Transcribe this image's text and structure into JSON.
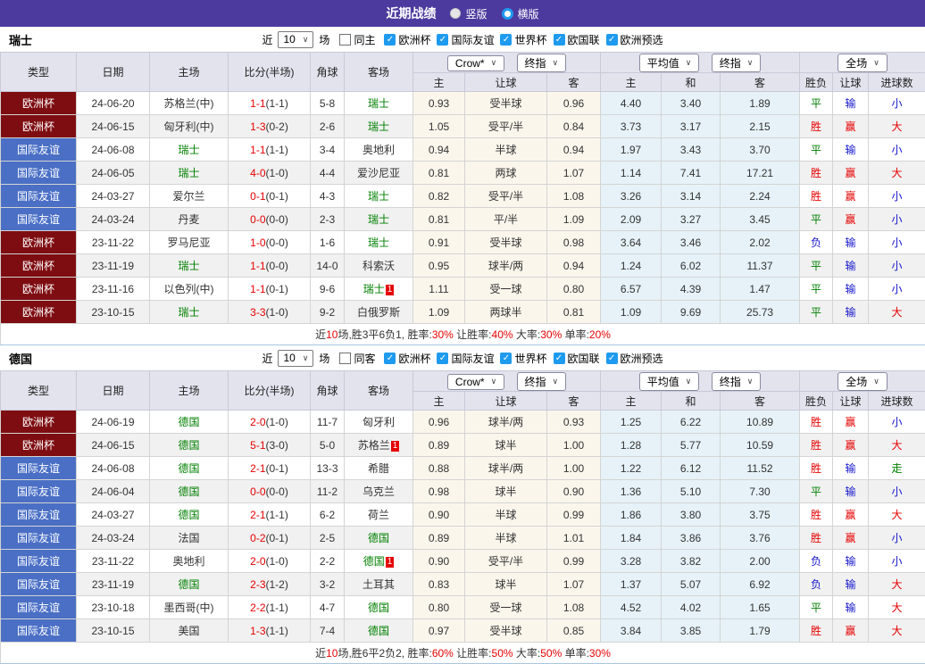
{
  "header": {
    "title": "近期战绩",
    "radio_vertical": "竖版",
    "radio_horizontal": "横版"
  },
  "filter": {
    "near_label": "近",
    "near_value": "10",
    "games_label": "场",
    "leagues": [
      "欧洲杯",
      "国际友谊",
      "世界杯",
      "欧国联",
      "欧洲预选"
    ]
  },
  "columns": {
    "main": [
      "类型",
      "日期",
      "主场",
      "比分(半场)",
      "角球",
      "客场"
    ],
    "sub": [
      "主",
      "让球",
      "客",
      "主",
      "和",
      "客",
      "胜负",
      "让球",
      "进球数"
    ],
    "dropdowns": {
      "crow": "Crow*",
      "final": "终指",
      "avg": "平均值",
      "full": "全场"
    }
  },
  "colors": {
    "topbar_bg": "#4C3A9E",
    "header_cell_bg": "#E3E3EE",
    "cup_bg": "#7E0D11",
    "friendly_bg": "#4A6FC5",
    "team_green": "#008000",
    "score_red": "#E60000",
    "result_red": "#E60000",
    "result_blue": "#1515CD",
    "result_green": "#008000",
    "crow_col_bg": "#FBF6EC",
    "avg_col_bg": "#E6F2F8",
    "stripe_bg": "#F1F1F1",
    "checkbox_blue": "#1E9AEF",
    "badge_red": "#E60000"
  },
  "tables": [
    {
      "team": "瑞士",
      "same_label": "同主",
      "rows": [
        {
          "league": "欧洲杯",
          "league_type": "cup",
          "date": "24-06-20",
          "home": "苏格兰(中)",
          "home_highlight": false,
          "home_badge": "",
          "score": "1-1",
          "half_score": "(1-1)",
          "corners": "5-8",
          "away": "瑞士",
          "away_highlight": true,
          "away_badge": "",
          "crow_home": "0.93",
          "handicap": "受半球",
          "crow_away": "0.96",
          "avg_home": "4.40",
          "avg_draw": "3.40",
          "avg_away": "1.89",
          "result_wdl": "平",
          "result_wdl_color": "green",
          "result_handicap": "输",
          "result_handicap_color": "blue",
          "result_goals": "小",
          "result_goals_color": "blue"
        },
        {
          "league": "欧洲杯",
          "league_type": "cup",
          "date": "24-06-15",
          "home": "匈牙利(中)",
          "home_highlight": false,
          "home_badge": "",
          "score": "1-3",
          "half_score": "(0-2)",
          "corners": "2-6",
          "away": "瑞士",
          "away_highlight": true,
          "away_badge": "",
          "crow_home": "1.05",
          "handicap": "受平/半",
          "crow_away": "0.84",
          "avg_home": "3.73",
          "avg_draw": "3.17",
          "avg_away": "2.15",
          "result_wdl": "胜",
          "result_wdl_color": "red",
          "result_handicap": "赢",
          "result_handicap_color": "red",
          "result_goals": "大",
          "result_goals_color": "red"
        },
        {
          "league": "国际友谊",
          "league_type": "friendly",
          "date": "24-06-08",
          "home": "瑞士",
          "home_highlight": true,
          "home_badge": "",
          "score": "1-1",
          "half_score": "(1-1)",
          "corners": "3-4",
          "away": "奥地利",
          "away_highlight": false,
          "away_badge": "",
          "crow_home": "0.94",
          "handicap": "半球",
          "crow_away": "0.94",
          "avg_home": "1.97",
          "avg_draw": "3.43",
          "avg_away": "3.70",
          "result_wdl": "平",
          "result_wdl_color": "green",
          "result_handicap": "输",
          "result_handicap_color": "blue",
          "result_goals": "小",
          "result_goals_color": "blue"
        },
        {
          "league": "国际友谊",
          "league_type": "friendly",
          "date": "24-06-05",
          "home": "瑞士",
          "home_highlight": true,
          "home_badge": "",
          "score": "4-0",
          "half_score": "(1-0)",
          "corners": "4-4",
          "away": "爱沙尼亚",
          "away_highlight": false,
          "away_badge": "",
          "crow_home": "0.81",
          "handicap": "两球",
          "crow_away": "1.07",
          "avg_home": "1.14",
          "avg_draw": "7.41",
          "avg_away": "17.21",
          "result_wdl": "胜",
          "result_wdl_color": "red",
          "result_handicap": "赢",
          "result_handicap_color": "red",
          "result_goals": "大",
          "result_goals_color": "red"
        },
        {
          "league": "国际友谊",
          "league_type": "friendly",
          "date": "24-03-27",
          "home": "爱尔兰",
          "home_highlight": false,
          "home_badge": "",
          "score": "0-1",
          "half_score": "(0-1)",
          "corners": "4-3",
          "away": "瑞士",
          "away_highlight": true,
          "away_badge": "",
          "crow_home": "0.82",
          "handicap": "受平/半",
          "crow_away": "1.08",
          "avg_home": "3.26",
          "avg_draw": "3.14",
          "avg_away": "2.24",
          "result_wdl": "胜",
          "result_wdl_color": "red",
          "result_handicap": "赢",
          "result_handicap_color": "red",
          "result_goals": "小",
          "result_goals_color": "blue"
        },
        {
          "league": "国际友谊",
          "league_type": "friendly",
          "date": "24-03-24",
          "home": "丹麦",
          "home_highlight": false,
          "home_badge": "",
          "score": "0-0",
          "half_score": "(0-0)",
          "corners": "2-3",
          "away": "瑞士",
          "away_highlight": true,
          "away_badge": "",
          "crow_home": "0.81",
          "handicap": "平/半",
          "crow_away": "1.09",
          "avg_home": "2.09",
          "avg_draw": "3.27",
          "avg_away": "3.45",
          "result_wdl": "平",
          "result_wdl_color": "green",
          "result_handicap": "赢",
          "result_handicap_color": "red",
          "result_goals": "小",
          "result_goals_color": "blue"
        },
        {
          "league": "欧洲杯",
          "league_type": "cup",
          "date": "23-11-22",
          "home": "罗马尼亚",
          "home_highlight": false,
          "home_badge": "",
          "score": "1-0",
          "half_score": "(0-0)",
          "corners": "1-6",
          "away": "瑞士",
          "away_highlight": true,
          "away_badge": "",
          "crow_home": "0.91",
          "handicap": "受半球",
          "crow_away": "0.98",
          "avg_home": "3.64",
          "avg_draw": "3.46",
          "avg_away": "2.02",
          "result_wdl": "负",
          "result_wdl_color": "blue",
          "result_handicap": "输",
          "result_handicap_color": "blue",
          "result_goals": "小",
          "result_goals_color": "blue"
        },
        {
          "league": "欧洲杯",
          "league_type": "cup",
          "date": "23-11-19",
          "home": "瑞士",
          "home_highlight": true,
          "home_badge": "",
          "score": "1-1",
          "half_score": "(0-0)",
          "corners": "14-0",
          "away": "科索沃",
          "away_highlight": false,
          "away_badge": "",
          "crow_home": "0.95",
          "handicap": "球半/两",
          "crow_away": "0.94",
          "avg_home": "1.24",
          "avg_draw": "6.02",
          "avg_away": "11.37",
          "result_wdl": "平",
          "result_wdl_color": "green",
          "result_handicap": "输",
          "result_handicap_color": "blue",
          "result_goals": "小",
          "result_goals_color": "blue"
        },
        {
          "league": "欧洲杯",
          "league_type": "cup",
          "date": "23-11-16",
          "home": "以色列(中)",
          "home_highlight": false,
          "home_badge": "",
          "score": "1-1",
          "half_score": "(0-1)",
          "corners": "9-6",
          "away": "瑞士",
          "away_highlight": true,
          "away_badge": "1",
          "crow_home": "1.11",
          "handicap": "受一球",
          "crow_away": "0.80",
          "avg_home": "6.57",
          "avg_draw": "4.39",
          "avg_away": "1.47",
          "result_wdl": "平",
          "result_wdl_color": "green",
          "result_handicap": "输",
          "result_handicap_color": "blue",
          "result_goals": "小",
          "result_goals_color": "blue"
        },
        {
          "league": "欧洲杯",
          "league_type": "cup",
          "date": "23-10-15",
          "home": "瑞士",
          "home_highlight": true,
          "home_badge": "",
          "score": "3-3",
          "half_score": "(1-0)",
          "corners": "9-2",
          "away": "白俄罗斯",
          "away_highlight": false,
          "away_badge": "",
          "crow_home": "1.09",
          "handicap": "两球半",
          "crow_away": "0.81",
          "avg_home": "1.09",
          "avg_draw": "9.69",
          "avg_away": "25.73",
          "result_wdl": "平",
          "result_wdl_color": "green",
          "result_handicap": "输",
          "result_handicap_color": "blue",
          "result_goals": "大",
          "result_goals_color": "red"
        }
      ],
      "summary": [
        {
          "text": "近",
          "red": false
        },
        {
          "text": "10",
          "red": true
        },
        {
          "text": "场,胜3平6负1, 胜率:",
          "red": false
        },
        {
          "text": "30%",
          "red": true
        },
        {
          "text": " 让胜率:",
          "red": false
        },
        {
          "text": "40%",
          "red": true
        },
        {
          "text": " 大率:",
          "red": false
        },
        {
          "text": "30%",
          "red": true
        },
        {
          "text": " 单率:",
          "red": false
        },
        {
          "text": "20%",
          "red": true
        }
      ]
    },
    {
      "team": "德国",
      "same_label": "同客",
      "rows": [
        {
          "league": "欧洲杯",
          "league_type": "cup",
          "date": "24-06-19",
          "home": "德国",
          "home_highlight": true,
          "home_badge": "",
          "score": "2-0",
          "half_score": "(1-0)",
          "corners": "11-7",
          "away": "匈牙利",
          "away_highlight": false,
          "away_badge": "",
          "crow_home": "0.96",
          "handicap": "球半/两",
          "crow_away": "0.93",
          "avg_home": "1.25",
          "avg_draw": "6.22",
          "avg_away": "10.89",
          "result_wdl": "胜",
          "result_wdl_color": "red",
          "result_handicap": "赢",
          "result_handicap_color": "red",
          "result_goals": "小",
          "result_goals_color": "blue"
        },
        {
          "league": "欧洲杯",
          "league_type": "cup",
          "date": "24-06-15",
          "home": "德国",
          "home_highlight": true,
          "home_badge": "",
          "score": "5-1",
          "half_score": "(3-0)",
          "corners": "5-0",
          "away": "苏格兰",
          "away_highlight": false,
          "away_badge": "1",
          "crow_home": "0.89",
          "handicap": "球半",
          "crow_away": "1.00",
          "avg_home": "1.28",
          "avg_draw": "5.77",
          "avg_away": "10.59",
          "result_wdl": "胜",
          "result_wdl_color": "red",
          "result_handicap": "赢",
          "result_handicap_color": "red",
          "result_goals": "大",
          "result_goals_color": "red"
        },
        {
          "league": "国际友谊",
          "league_type": "friendly",
          "date": "24-06-08",
          "home": "德国",
          "home_highlight": true,
          "home_badge": "",
          "score": "2-1",
          "half_score": "(0-1)",
          "corners": "13-3",
          "away": "希腊",
          "away_highlight": false,
          "away_badge": "",
          "crow_home": "0.88",
          "handicap": "球半/两",
          "crow_away": "1.00",
          "avg_home": "1.22",
          "avg_draw": "6.12",
          "avg_away": "11.52",
          "result_wdl": "胜",
          "result_wdl_color": "red",
          "result_handicap": "输",
          "result_handicap_color": "blue",
          "result_goals": "走",
          "result_goals_color": "green"
        },
        {
          "league": "国际友谊",
          "league_type": "friendly",
          "date": "24-06-04",
          "home": "德国",
          "home_highlight": true,
          "home_badge": "",
          "score": "0-0",
          "half_score": "(0-0)",
          "corners": "11-2",
          "away": "乌克兰",
          "away_highlight": false,
          "away_badge": "",
          "crow_home": "0.98",
          "handicap": "球半",
          "crow_away": "0.90",
          "avg_home": "1.36",
          "avg_draw": "5.10",
          "avg_away": "7.30",
          "result_wdl": "平",
          "result_wdl_color": "green",
          "result_handicap": "输",
          "result_handicap_color": "blue",
          "result_goals": "小",
          "result_goals_color": "blue"
        },
        {
          "league": "国际友谊",
          "league_type": "friendly",
          "date": "24-03-27",
          "home": "德国",
          "home_highlight": true,
          "home_badge": "",
          "score": "2-1",
          "half_score": "(1-1)",
          "corners": "6-2",
          "away": "荷兰",
          "away_highlight": false,
          "away_badge": "",
          "crow_home": "0.90",
          "handicap": "半球",
          "crow_away": "0.99",
          "avg_home": "1.86",
          "avg_draw": "3.80",
          "avg_away": "3.75",
          "result_wdl": "胜",
          "result_wdl_color": "red",
          "result_handicap": "赢",
          "result_handicap_color": "red",
          "result_goals": "大",
          "result_goals_color": "red"
        },
        {
          "league": "国际友谊",
          "league_type": "friendly",
          "date": "24-03-24",
          "home": "法国",
          "home_highlight": false,
          "home_badge": "",
          "score": "0-2",
          "half_score": "(0-1)",
          "corners": "2-5",
          "away": "德国",
          "away_highlight": true,
          "away_badge": "",
          "crow_home": "0.89",
          "handicap": "半球",
          "crow_away": "1.01",
          "avg_home": "1.84",
          "avg_draw": "3.86",
          "avg_away": "3.76",
          "result_wdl": "胜",
          "result_wdl_color": "red",
          "result_handicap": "赢",
          "result_handicap_color": "red",
          "result_goals": "小",
          "result_goals_color": "blue"
        },
        {
          "league": "国际友谊",
          "league_type": "friendly",
          "date": "23-11-22",
          "home": "奥地利",
          "home_highlight": false,
          "home_badge": "",
          "score": "2-0",
          "half_score": "(1-0)",
          "corners": "2-2",
          "away": "德国",
          "away_highlight": true,
          "away_badge": "1",
          "crow_home": "0.90",
          "handicap": "受平/半",
          "crow_away": "0.99",
          "avg_home": "3.28",
          "avg_draw": "3.82",
          "avg_away": "2.00",
          "result_wdl": "负",
          "result_wdl_color": "blue",
          "result_handicap": "输",
          "result_handicap_color": "blue",
          "result_goals": "小",
          "result_goals_color": "blue"
        },
        {
          "league": "国际友谊",
          "league_type": "friendly",
          "date": "23-11-19",
          "home": "德国",
          "home_highlight": true,
          "home_badge": "",
          "score": "2-3",
          "half_score": "(1-2)",
          "corners": "3-2",
          "away": "土耳其",
          "away_highlight": false,
          "away_badge": "",
          "crow_home": "0.83",
          "handicap": "球半",
          "crow_away": "1.07",
          "avg_home": "1.37",
          "avg_draw": "5.07",
          "avg_away": "6.92",
          "result_wdl": "负",
          "result_wdl_color": "blue",
          "result_handicap": "输",
          "result_handicap_color": "blue",
          "result_goals": "大",
          "result_goals_color": "red"
        },
        {
          "league": "国际友谊",
          "league_type": "friendly",
          "date": "23-10-18",
          "home": "墨西哥(中)",
          "home_highlight": false,
          "home_badge": "",
          "score": "2-2",
          "half_score": "(1-1)",
          "corners": "4-7",
          "away": "德国",
          "away_highlight": true,
          "away_badge": "",
          "crow_home": "0.80",
          "handicap": "受一球",
          "crow_away": "1.08",
          "avg_home": "4.52",
          "avg_draw": "4.02",
          "avg_away": "1.65",
          "result_wdl": "平",
          "result_wdl_color": "green",
          "result_handicap": "输",
          "result_handicap_color": "blue",
          "result_goals": "大",
          "result_goals_color": "red"
        },
        {
          "league": "国际友谊",
          "league_type": "friendly",
          "date": "23-10-15",
          "home": "美国",
          "home_highlight": false,
          "home_badge": "",
          "score": "1-3",
          "half_score": "(1-1)",
          "corners": "7-4",
          "away": "德国",
          "away_highlight": true,
          "away_badge": "",
          "crow_home": "0.97",
          "handicap": "受半球",
          "crow_away": "0.85",
          "avg_home": "3.84",
          "avg_draw": "3.85",
          "avg_away": "1.79",
          "result_wdl": "胜",
          "result_wdl_color": "red",
          "result_handicap": "赢",
          "result_handicap_color": "red",
          "result_goals": "大",
          "result_goals_color": "red"
        }
      ],
      "summary": [
        {
          "text": "近",
          "red": false
        },
        {
          "text": "10",
          "red": true
        },
        {
          "text": "场,胜6平2负2, 胜率:",
          "red": false
        },
        {
          "text": "60%",
          "red": true
        },
        {
          "text": " 让胜率:",
          "red": false
        },
        {
          "text": "50%",
          "red": true
        },
        {
          "text": " 大率:",
          "red": false
        },
        {
          "text": "50%",
          "red": true
        },
        {
          "text": " 单率:",
          "red": false
        },
        {
          "text": "30%",
          "red": true
        }
      ]
    }
  ]
}
